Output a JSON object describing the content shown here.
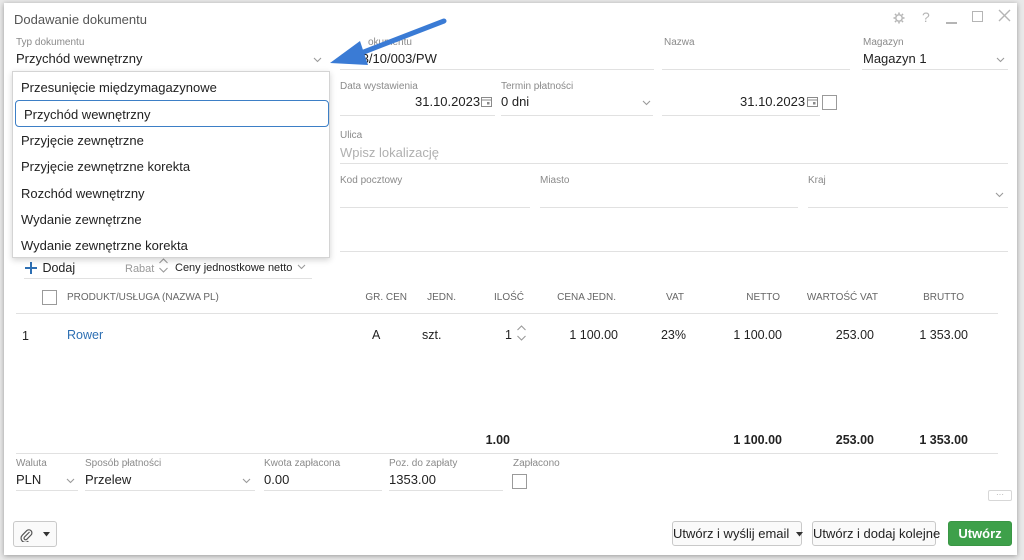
{
  "window": {
    "title": "Dodawanie dokumentu"
  },
  "colors": {
    "accent": "#3d7fc6",
    "primary_button": "#3ea04a",
    "link": "#2d6fb3"
  },
  "document": {
    "type_label": "Typ dokumentu",
    "type_value": "Przychód wewnętrzny",
    "number_label": "Numer dokumentu",
    "number_label_visible": "okumentu",
    "number_value": "2023/10/003/PW",
    "name_label": "Nazwa",
    "warehouse_label": "Magazyn",
    "warehouse_value": "Magazyn 1",
    "issue_date_label": "Data wystawienia",
    "issue_date_value": "31.10.2023",
    "payment_term_label": "Termin płatności",
    "payment_term_value": "0 dni",
    "due_date_value": "31.10.2023"
  },
  "dropdown": {
    "items": [
      "Przesunięcie międzymagazynowe",
      "Przychód wewnętrzny",
      "Przyjęcie zewnętrzne",
      "Przyjęcie zewnętrzne korekta",
      "Rozchód wewnętrzny",
      "Wydanie zewnętrzne",
      "Wydanie zewnętrzne korekta"
    ],
    "selected": "Przychód wewnętrzny"
  },
  "address": {
    "street_label": "Ulica",
    "street_placeholder": "Wpisz lokalizację",
    "postal_label": "Kod pocztowy",
    "city_label": "Miasto",
    "country_label": "Kraj"
  },
  "toolbar": {
    "add_label": "Dodaj",
    "discount_label": "Rabat",
    "price_mode": "Ceny jednostkowe netto"
  },
  "table": {
    "headers": {
      "product": "PRODUKT/USŁUGA (NAZWA PL)",
      "price_group": "GR. CEN",
      "unit": "JEDN.",
      "qty": "ILOŚĆ",
      "unit_price": "CENA JEDN.",
      "vat": "VAT",
      "net": "NETTO",
      "vat_value": "WARTOŚĆ VAT",
      "gross": "BRUTTO"
    },
    "rows": [
      {
        "lp": "1",
        "product": "Rower",
        "price_group": "A",
        "unit": "szt.",
        "qty": "1",
        "unit_price": "1 100.00",
        "vat": "23%",
        "net": "1 100.00",
        "vat_value": "253.00",
        "gross": "1 353.00"
      }
    ],
    "totals": {
      "qty": "1.00",
      "net": "1 100.00",
      "vat_value": "253.00",
      "gross": "1 353.00"
    }
  },
  "payment": {
    "currency_label": "Waluta",
    "currency_value": "PLN",
    "method_label": "Sposób płatności",
    "method_value": "Przelew",
    "paid_amount_label": "Kwota zapłacona",
    "paid_amount_value": "0.00",
    "to_pay_label": "Poz. do zapłaty",
    "to_pay_value": "1353.00",
    "paid_label": "Zapłacono"
  },
  "footer": {
    "create_email_label": "Utwórz i wyślij email",
    "create_next_label": "Utwórz i dodaj kolejne",
    "create_label": "Utwórz",
    "more_label": "···"
  }
}
